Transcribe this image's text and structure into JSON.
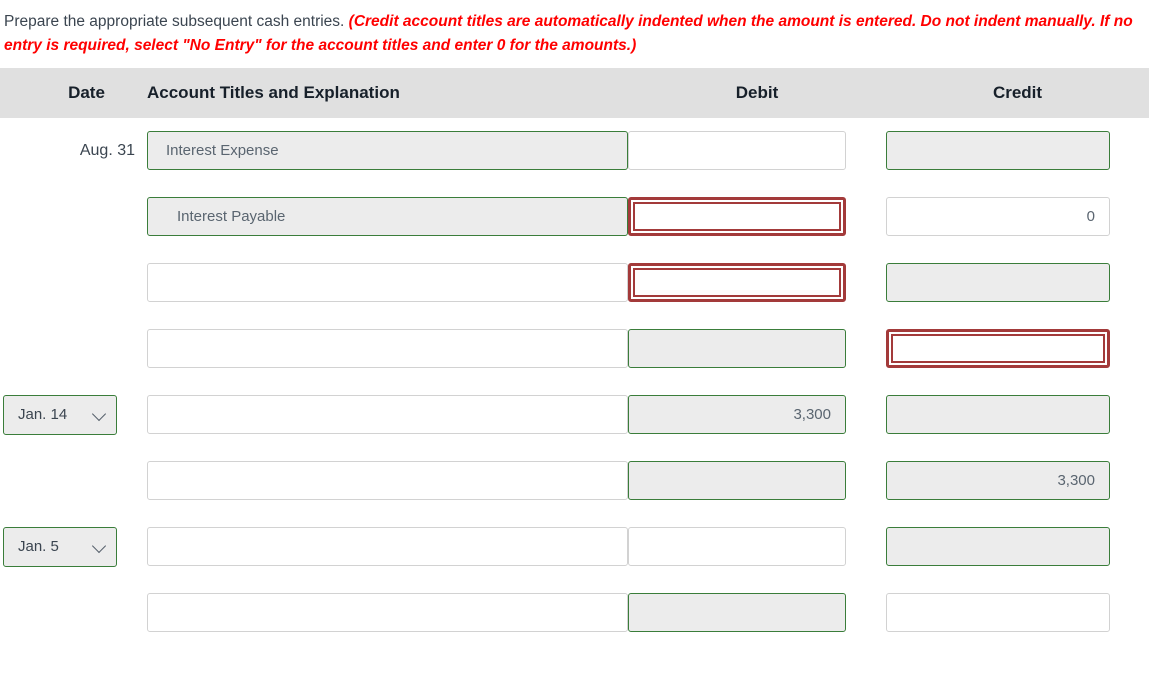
{
  "instructions": {
    "plain_text": "Prepare the appropriate subsequent cash entries.",
    "alert_text": "(Credit account titles are automatically indented when the amount is entered. Do not indent manually. If no entry is required, select \"No Entry\" for the account titles and enter 0 for the amounts.)"
  },
  "table": {
    "headers": {
      "date": "Date",
      "account": "Account Titles and Explanation",
      "debit": "Debit",
      "credit": "Credit"
    },
    "rows": [
      {
        "date_type": "label",
        "date_value": "Aug. 31",
        "account_value": "Interest Expense",
        "account_indent": false,
        "account_state": "filled",
        "debit_value": "",
        "debit_state": "plain",
        "credit_value": "",
        "credit_state": "filled"
      },
      {
        "date_type": "none",
        "date_value": "",
        "account_value": "Interest Payable",
        "account_indent": true,
        "account_state": "filled",
        "debit_value": "",
        "debit_state": "error",
        "credit_value": "0",
        "credit_state": "plain"
      },
      {
        "date_type": "none",
        "date_value": "",
        "account_value": "",
        "account_indent": false,
        "account_state": "plain",
        "debit_value": "",
        "debit_state": "error",
        "credit_value": "",
        "credit_state": "filled"
      },
      {
        "date_type": "none",
        "date_value": "",
        "account_value": "",
        "account_indent": false,
        "account_state": "plain",
        "debit_value": "",
        "debit_state": "filled",
        "credit_value": "",
        "credit_state": "error"
      },
      {
        "date_type": "select",
        "date_value": "Jan. 14",
        "account_value": "",
        "account_indent": false,
        "account_state": "plain",
        "debit_value": "3,300",
        "debit_state": "filled",
        "credit_value": "",
        "credit_state": "filled"
      },
      {
        "date_type": "none",
        "date_value": "",
        "account_value": "",
        "account_indent": false,
        "account_state": "plain",
        "debit_value": "",
        "debit_state": "filled",
        "credit_value": "3,300",
        "credit_state": "filled"
      },
      {
        "date_type": "select",
        "date_value": "Jan. 5",
        "account_value": "",
        "account_indent": false,
        "account_state": "plain",
        "debit_value": "",
        "debit_state": "plain",
        "credit_value": "",
        "credit_state": "filled"
      },
      {
        "date_type": "none",
        "date_value": "",
        "account_value": "",
        "account_indent": false,
        "account_state": "plain",
        "debit_value": "",
        "debit_state": "filled",
        "credit_value": "",
        "credit_state": "plain"
      }
    ]
  },
  "colors": {
    "alert_red": "#ff0000",
    "error_border": "#a33a3a",
    "valid_border": "#3a7d3a",
    "filled_bg": "#ececec",
    "header_bg": "#e0e0e0",
    "text": "#3b4550"
  }
}
